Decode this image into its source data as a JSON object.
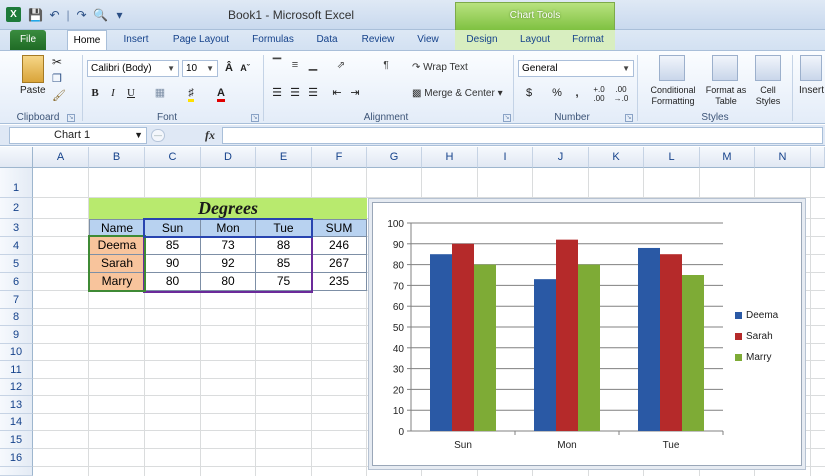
{
  "window": {
    "title": "Book1 - Microsoft Excel",
    "context_tab_title": "Chart Tools",
    "app_icon": "X"
  },
  "qat": {
    "icons": [
      "save-icon",
      "undo-icon",
      "redo-icon",
      "print-preview-icon",
      "customize-icon"
    ]
  },
  "tabs": [
    {
      "label": "File"
    },
    {
      "label": "Home"
    },
    {
      "label": "Insert"
    },
    {
      "label": "Page Layout"
    },
    {
      "label": "Formulas"
    },
    {
      "label": "Data"
    },
    {
      "label": "Review"
    },
    {
      "label": "View"
    },
    {
      "label": "Design"
    },
    {
      "label": "Layout"
    },
    {
      "label": "Format"
    }
  ],
  "ribbon": {
    "clipboard": {
      "label": "Clipboard",
      "paste": "Paste"
    },
    "font": {
      "label": "Font",
      "name": "Calibri (Body)",
      "size": "10",
      "bold": "B",
      "italic": "I",
      "underline": "U"
    },
    "alignment": {
      "label": "Alignment",
      "wrap_text": "Wrap Text",
      "merge_center": "Merge & Center"
    },
    "number": {
      "label": "Number",
      "format": "General",
      "currency": "$",
      "percent": "%",
      "comma": ","
    },
    "styles": {
      "label": "Styles",
      "conditional": "Conditional Formatting",
      "format_table": "Format as Table",
      "cell_styles": "Cell Styles"
    },
    "cells": {
      "insert": "Insert"
    }
  },
  "formula_bar": {
    "name_box": "Chart 1",
    "fx": "fx",
    "value": ""
  },
  "columns": [
    "A",
    "B",
    "C",
    "D",
    "E",
    "F",
    "G",
    "H",
    "I",
    "J",
    "K",
    "L",
    "M",
    "N"
  ],
  "rows": [
    "1",
    "2",
    "3",
    "4",
    "5",
    "6",
    "7",
    "8",
    "9",
    "10",
    "11",
    "12",
    "13",
    "14",
    "15",
    "16"
  ],
  "table": {
    "title": "Degrees",
    "headers": [
      "Name",
      "Sun",
      "Mon",
      "Tue",
      "SUM"
    ],
    "rows": [
      {
        "name": "Deema",
        "values": [
          "85",
          "73",
          "88",
          "246"
        ]
      },
      {
        "name": "Sarah",
        "values": [
          "90",
          "92",
          "85",
          "267"
        ]
      },
      {
        "name": "Marry",
        "values": [
          "80",
          "80",
          "75",
          "235"
        ]
      }
    ]
  },
  "chart_data": {
    "type": "bar",
    "categories": [
      "Sun",
      "Mon",
      "Tue"
    ],
    "series": [
      {
        "name": "Deema",
        "values": [
          85,
          73,
          88
        ],
        "color": "#2a59a5"
      },
      {
        "name": "Sarah",
        "values": [
          90,
          92,
          85
        ],
        "color": "#b52a2a"
      },
      {
        "name": "Marry",
        "values": [
          80,
          80,
          75
        ],
        "color": "#7eab36"
      }
    ],
    "ylim": [
      0,
      100
    ],
    "yticks": [
      0,
      10,
      20,
      30,
      40,
      50,
      60,
      70,
      80,
      90,
      100
    ],
    "grid": true,
    "legend": "right"
  }
}
